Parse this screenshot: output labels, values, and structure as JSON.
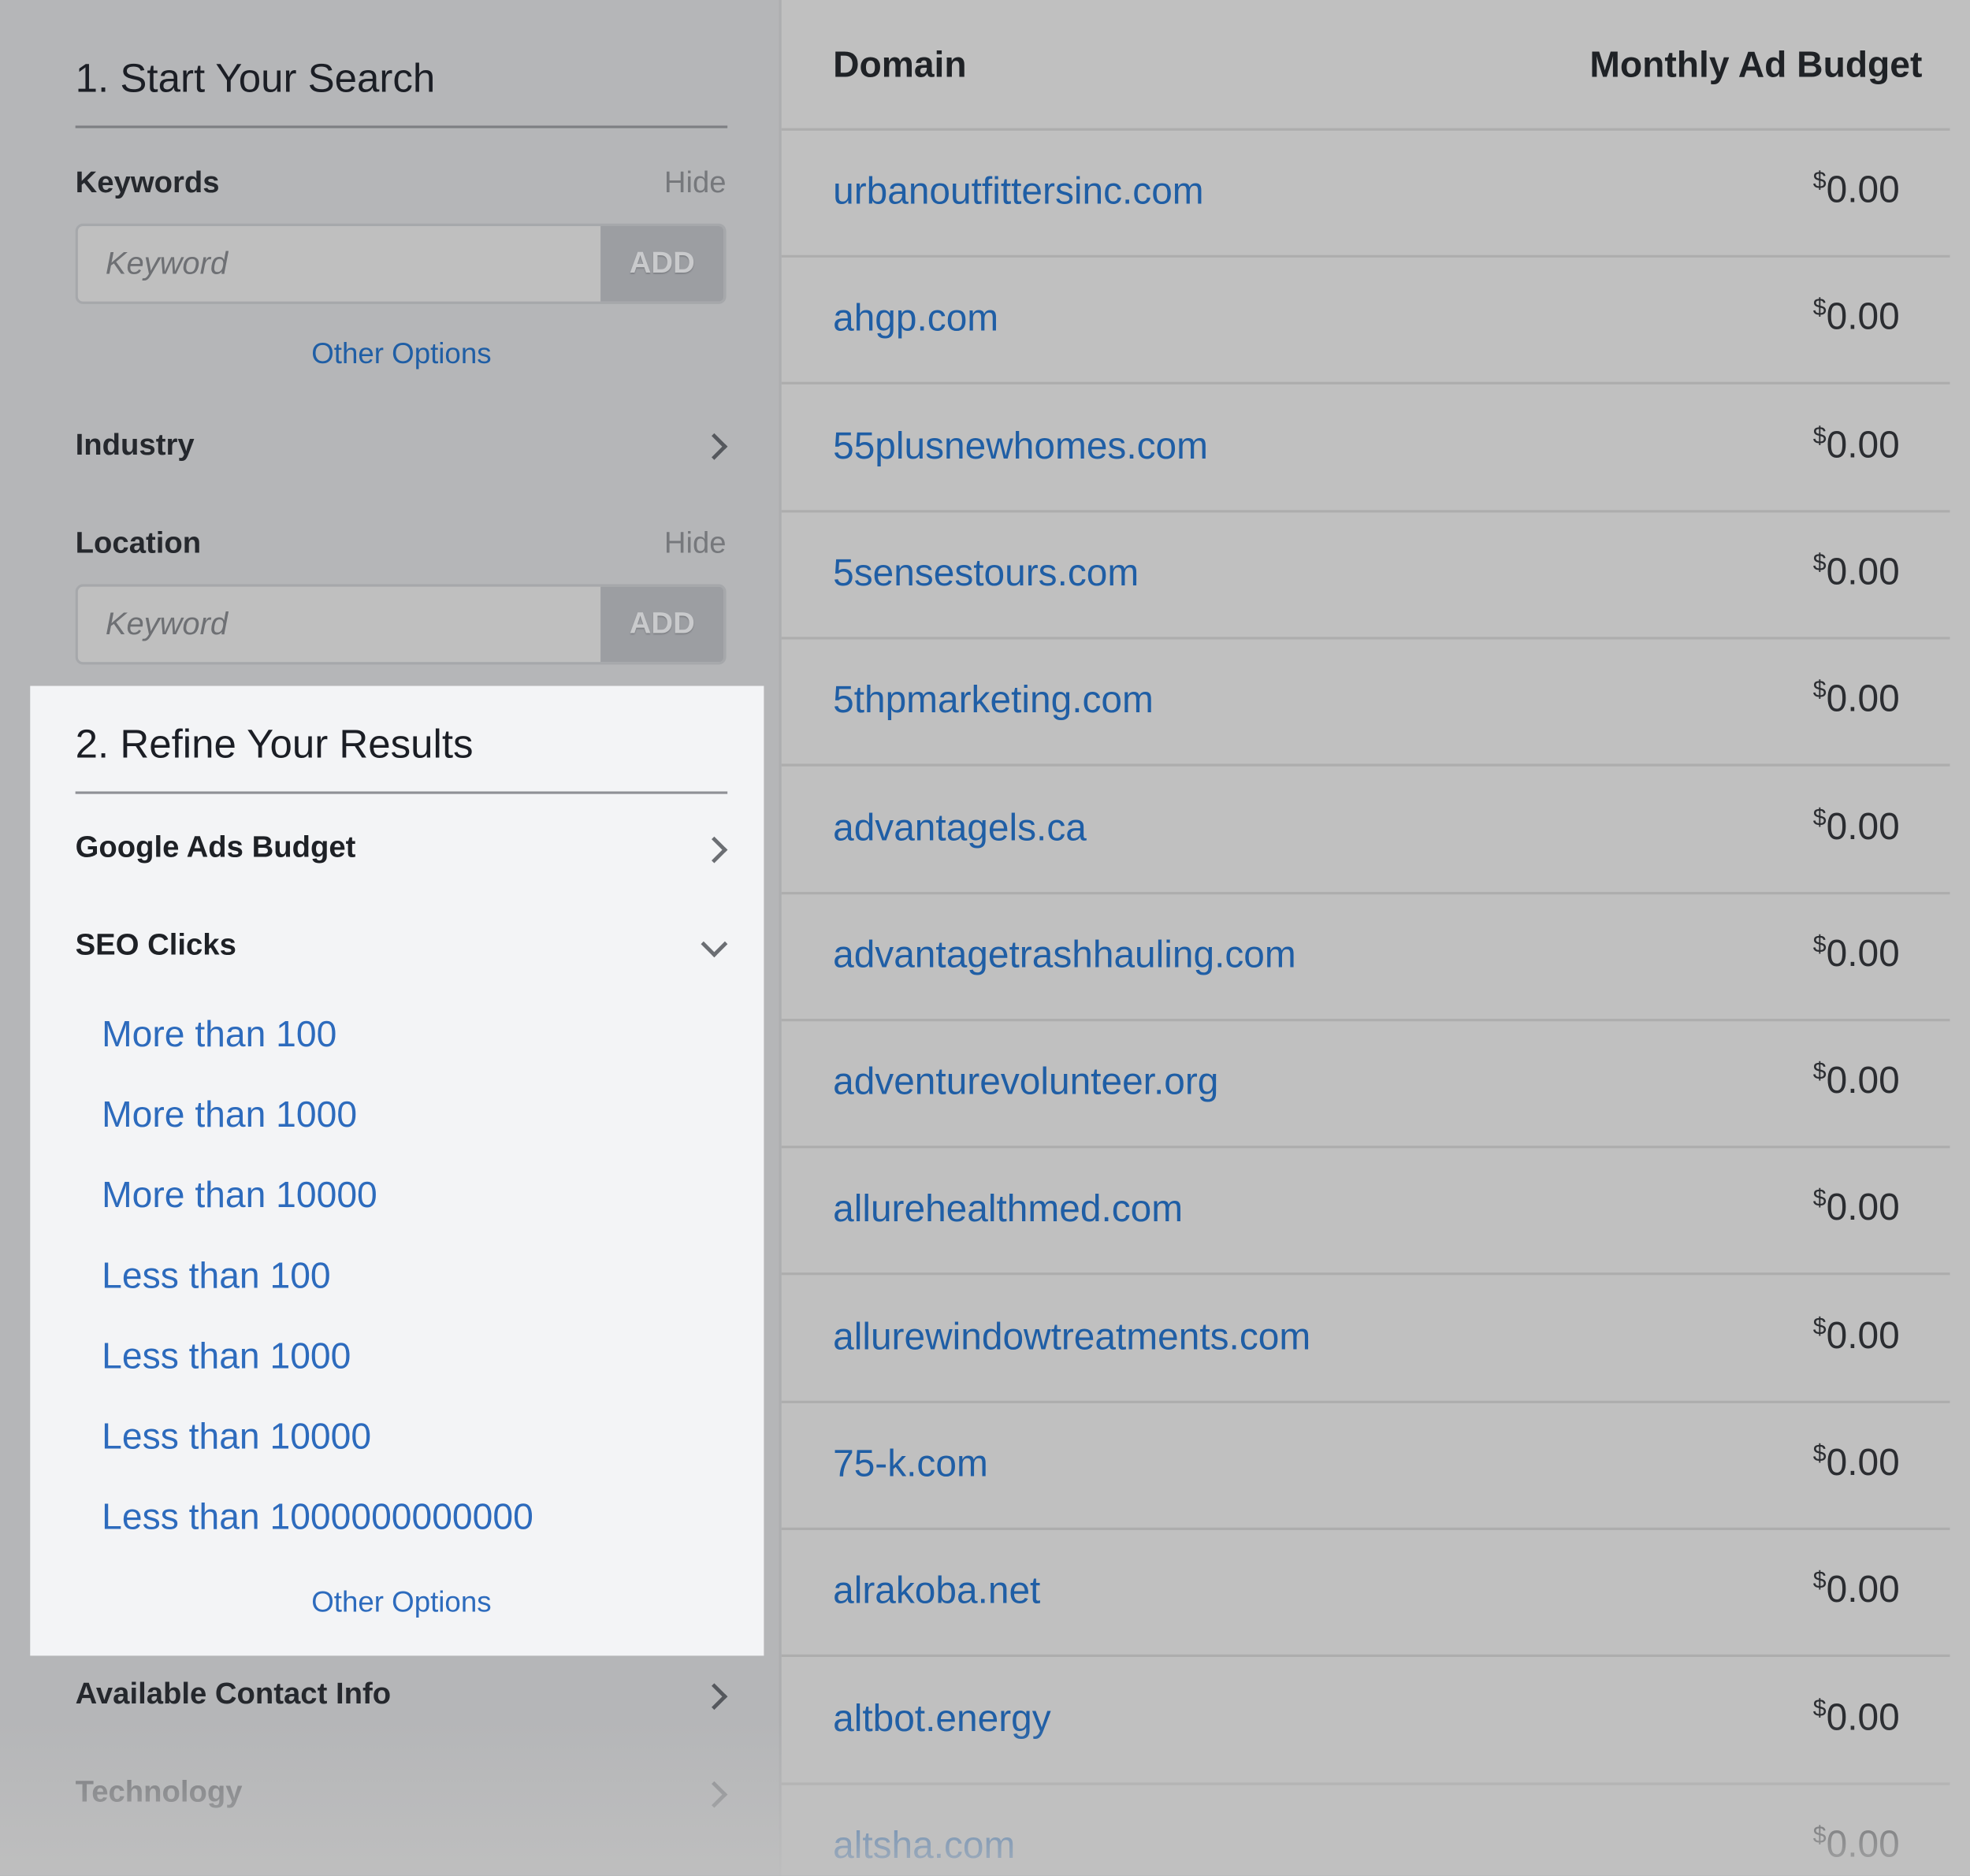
{
  "sidebar": {
    "start_title": "1. Start Your Search",
    "keywords": {
      "label": "Keywords",
      "hide": "Hide",
      "placeholder": "Keyword",
      "add": "ADD",
      "other_options": "Other Options"
    },
    "industry": {
      "label": "Industry"
    },
    "location": {
      "label": "Location",
      "hide": "Hide",
      "placeholder": "Keyword",
      "add": "ADD"
    },
    "refine_title": "2. Refine Your Results",
    "google_ads_budget": {
      "label": "Google Ads Budget"
    },
    "seo_clicks": {
      "label": "SEO Clicks",
      "options": [
        "More than 100",
        "More than 1000",
        "More than 10000",
        "Less than 100",
        "Less than 1000",
        "Less than 10000",
        "Less than 1000000000000"
      ],
      "other_options": "Other Options"
    },
    "available_contact_info": {
      "label": "Available Contact Info"
    },
    "technology": {
      "label": "Technology"
    }
  },
  "table": {
    "columns": [
      "Domain",
      "Monthly Ad Budget"
    ],
    "currency_symbol": "$",
    "rows": [
      {
        "domain": "urbanoutfittersinc.com",
        "budget": "0.00"
      },
      {
        "domain": "ahgp.com",
        "budget": "0.00"
      },
      {
        "domain": "55plusnewhomes.com",
        "budget": "0.00"
      },
      {
        "domain": "5sensestours.com",
        "budget": "0.00"
      },
      {
        "domain": "5thpmarketing.com",
        "budget": "0.00"
      },
      {
        "domain": "advantagels.ca",
        "budget": "0.00"
      },
      {
        "domain": "advantagetrashhauling.com",
        "budget": "0.00"
      },
      {
        "domain": "adventurevolunteer.org",
        "budget": "0.00"
      },
      {
        "domain": "allurehealthmed.com",
        "budget": "0.00"
      },
      {
        "domain": "allurewindowtreatments.com",
        "budget": "0.00"
      },
      {
        "domain": "75-k.com",
        "budget": "0.00"
      },
      {
        "domain": "alrakoba.net",
        "budget": "0.00"
      },
      {
        "domain": "altbot.energy",
        "budget": "0.00"
      },
      {
        "domain": "altsha.com",
        "budget": "0.00"
      }
    ]
  },
  "colors": {
    "link": "#1f5ea5",
    "highlight_panel": "#f3f4f6",
    "overlay": "#b5b6b8"
  }
}
